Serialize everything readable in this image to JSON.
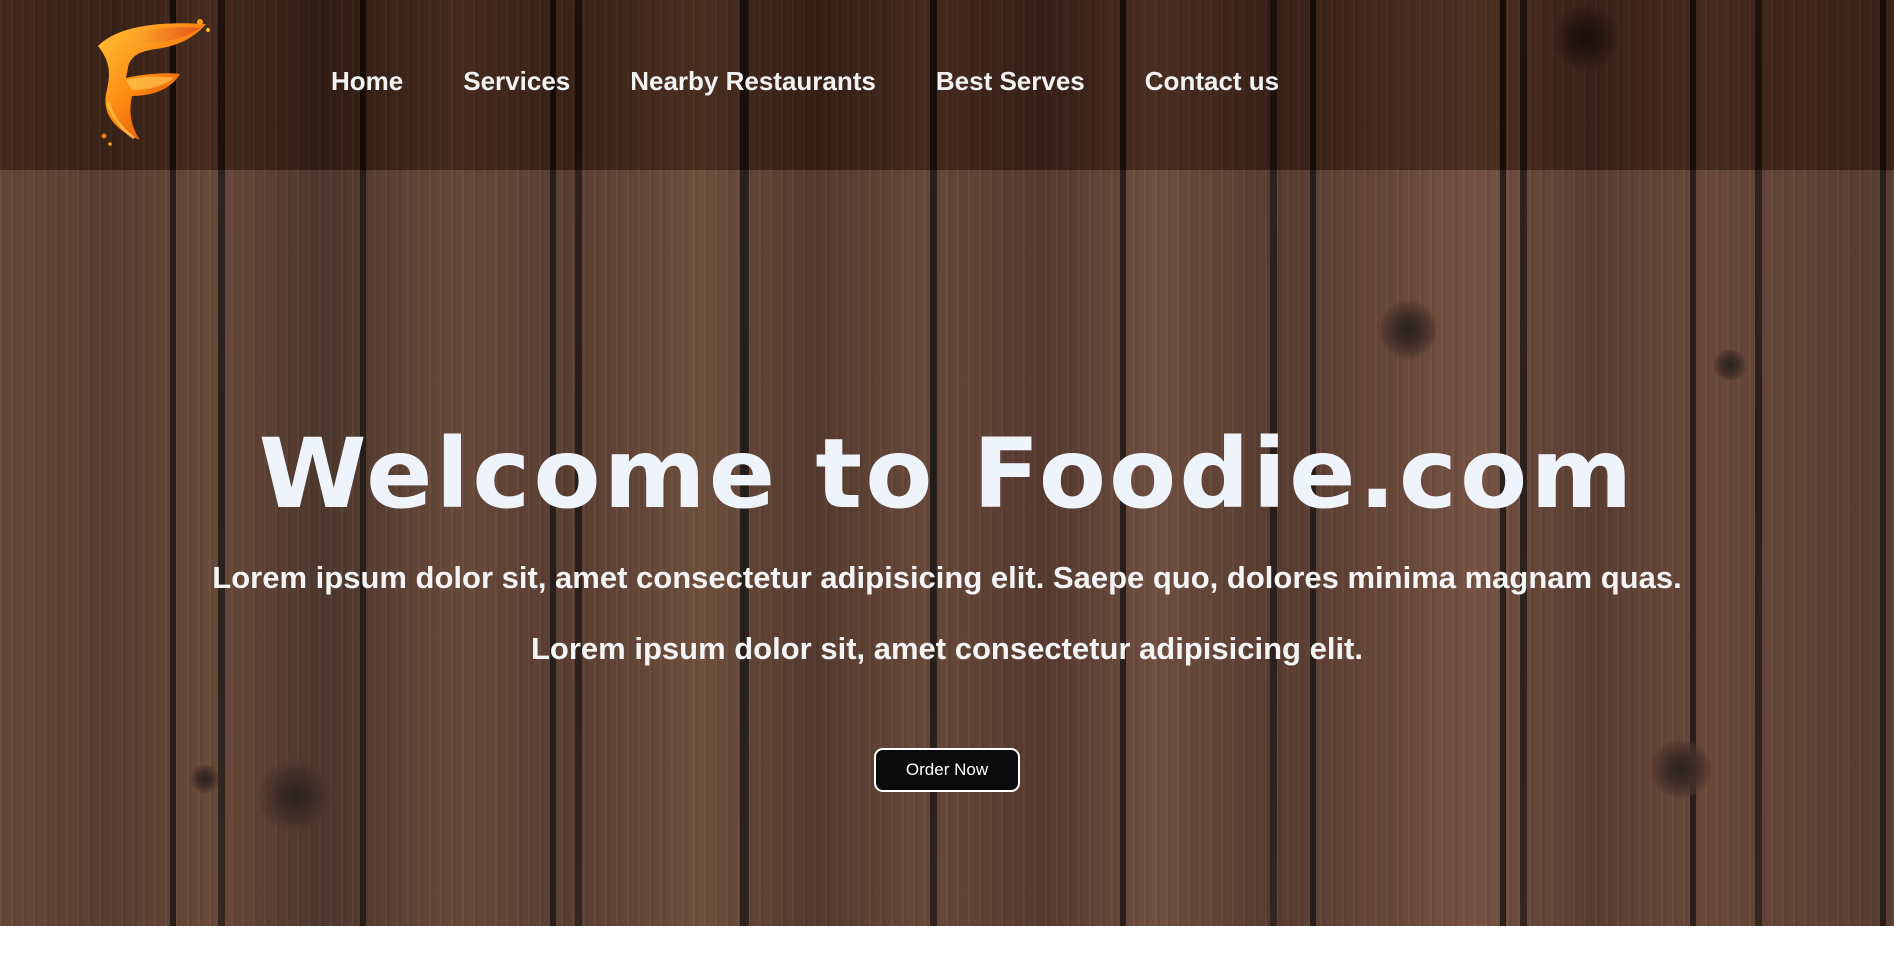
{
  "brand": {
    "logo_letter": "F",
    "logo_colors": [
      "#ff9d1c",
      "#e8541a",
      "#c2260f"
    ]
  },
  "nav": {
    "items": [
      {
        "label": "Home"
      },
      {
        "label": "Services"
      },
      {
        "label": "Nearby Restaurants"
      },
      {
        "label": "Best Serves"
      },
      {
        "label": "Contact us"
      }
    ]
  },
  "hero": {
    "title": "Welcome to Foodie.com",
    "subtitle_1": "Lorem ipsum dolor sit, amet consectetur adipisicing elit. Saepe quo, dolores minima magnam quas.",
    "subtitle_2": "Lorem ipsum dolor sit, amet consectetur adipisicing elit.",
    "cta_label": "Order Now"
  },
  "theme": {
    "background": "wood-planks",
    "text_color": "#f4f4f4",
    "button_bg": "#0b0b0b",
    "button_border": "#ffffff"
  }
}
